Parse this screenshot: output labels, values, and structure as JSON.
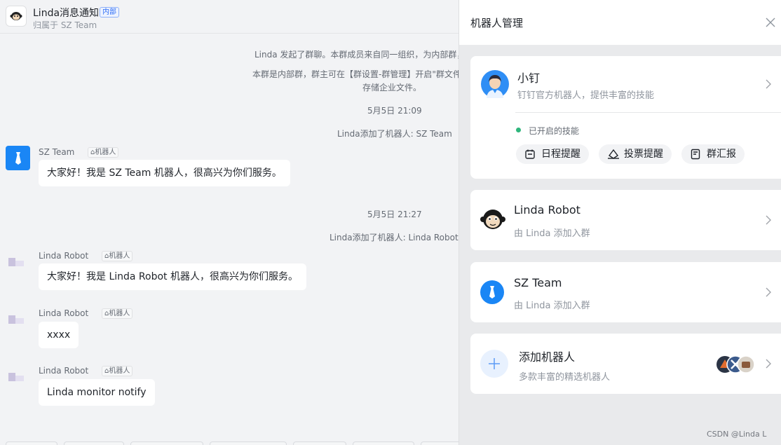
{
  "header": {
    "group_name": "Linda消息通知",
    "internal_tag": "内部",
    "subtitle": "归属于 SZ Team"
  },
  "system_messages": {
    "started_group": "Linda 发起了群聊。本群成员来自同一组织，为内部群，",
    "internal_note_line1": "本群是内部群，群主可在【群设置-群管理】开启\"群文件",
    "internal_note_line2": "存储企业文件。",
    "time1": "5月5日 21:09",
    "added_bot1": "Linda添加了机器人: SZ Team",
    "time2": "5月5日 21:27",
    "added_bot2": "Linda添加了机器人: Linda Robot"
  },
  "messages": [
    {
      "sender": "SZ Team",
      "tag": "机器人",
      "text": "大家好！我是 SZ Team 机器人，很高兴为你们服务。"
    },
    {
      "sender": "Linda Robot",
      "tag": "机器人",
      "text": "大家好！我是 Linda Robot 机器人，很高兴为你们服务。"
    },
    {
      "sender": "Linda Robot",
      "tag": "机器人",
      "text": "xxxx"
    },
    {
      "sender": "Linda Robot",
      "tag": "机器人",
      "text": "Linda monitor notify"
    }
  ],
  "panel": {
    "title": "机器人管理",
    "official": {
      "name": "小钉",
      "desc": "钉钉官方机器人，提供丰富的技能",
      "skills_title": "已开启的技能",
      "skills": [
        "日程提醒",
        "投票提醒",
        "群汇报"
      ]
    },
    "bots": [
      {
        "name": "Linda Robot",
        "desc": "由 Linda 添加入群"
      },
      {
        "name": "SZ Team",
        "desc": "由 Linda 添加入群"
      }
    ],
    "add": {
      "name": "添加机器人",
      "desc": "多款丰富的精选机器人"
    }
  },
  "watermark": "CSDN @Linda L",
  "colors": {
    "accent_blue": "#1a86f5",
    "skill_green": "#2fb67c",
    "background": "#f2f3f5"
  }
}
